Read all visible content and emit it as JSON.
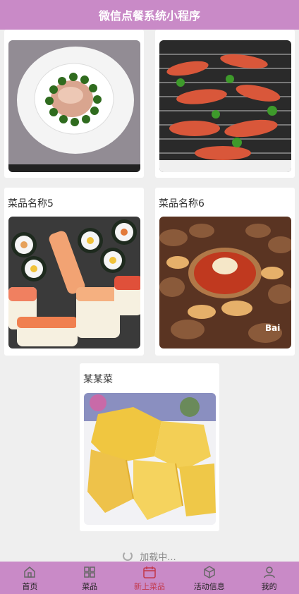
{
  "app": {
    "title": "微信点餐系统小程序"
  },
  "dishes": [
    {
      "name": "",
      "photo": "plate-of-vegetables-and-meat-photo"
    },
    {
      "name": "",
      "photo": "grilled-shrimp-photo"
    },
    {
      "name": "菜品名称5",
      "photo": "sushi-photo"
    },
    {
      "name": "菜品名称6",
      "photo": "hotpot-feast-photo"
    },
    {
      "name": "某某菜",
      "photo": "chicken-dish-photo"
    }
  ],
  "loading": {
    "text": "加载中..."
  },
  "tabbar": {
    "items": [
      {
        "label": "首页",
        "icon": "home-icon"
      },
      {
        "label": "菜品",
        "icon": "grid-icon"
      },
      {
        "label": "新上菜品",
        "icon": "calendar-icon",
        "active": true
      },
      {
        "label": "活动信息",
        "icon": "box-icon"
      },
      {
        "label": "我的",
        "icon": "user-icon"
      }
    ]
  },
  "colors": {
    "brand": "#c98ac7",
    "active_tab": "#c23b4e"
  }
}
